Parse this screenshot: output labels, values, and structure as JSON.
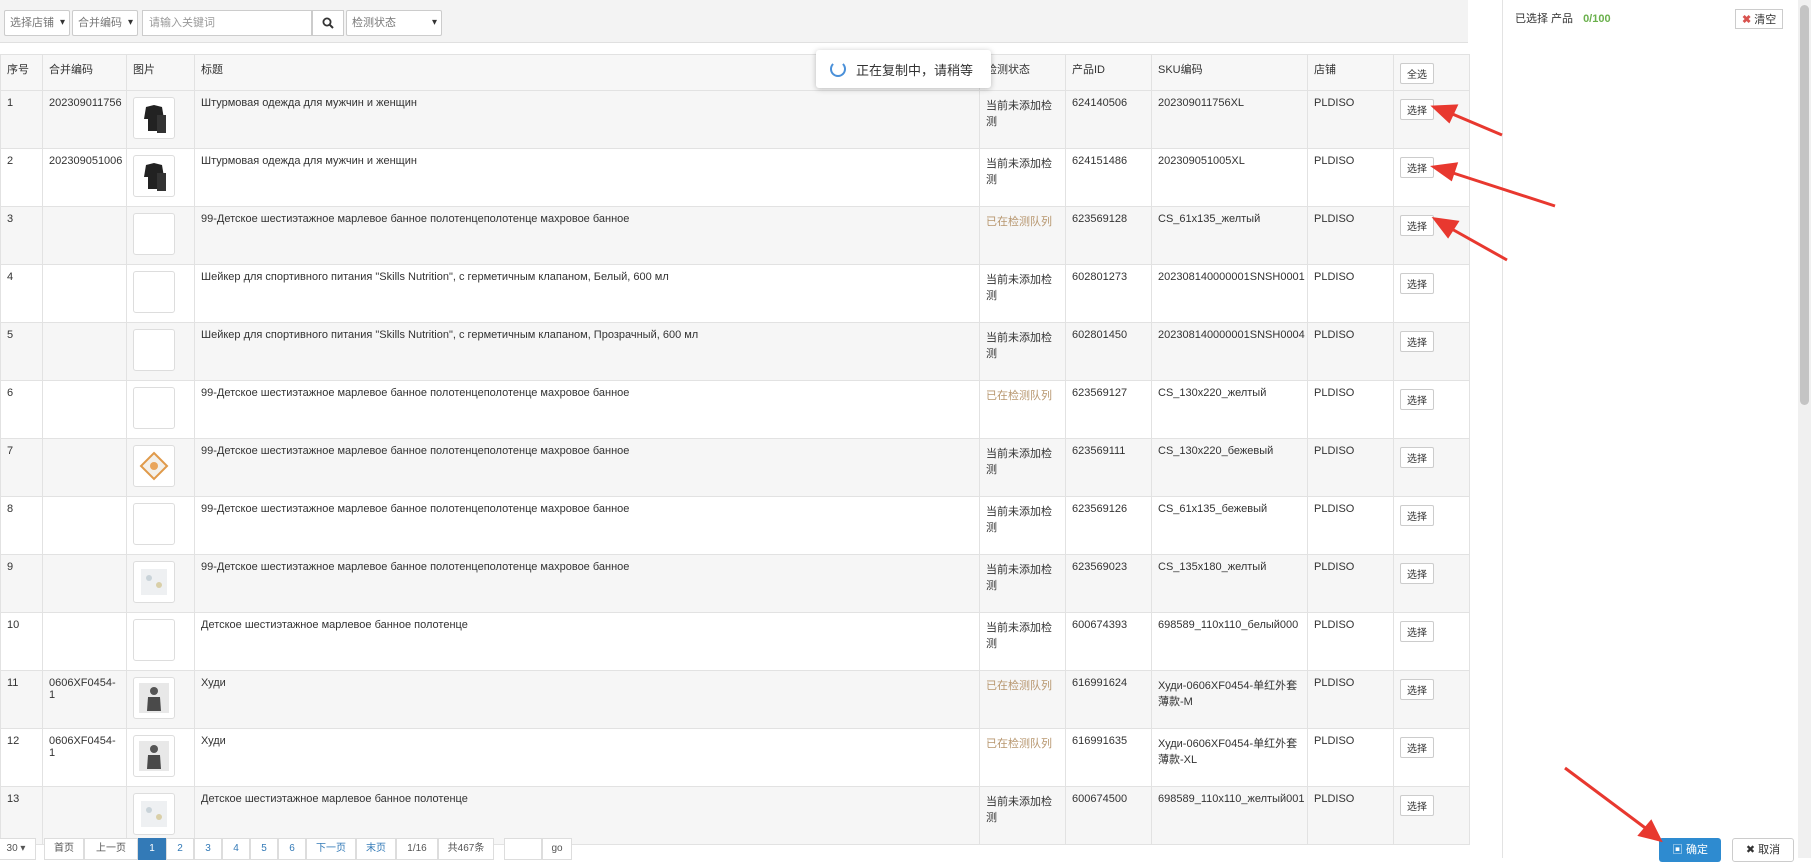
{
  "toolbar": {
    "store_select": "选择店铺",
    "merge_select": "合并编码",
    "search_placeholder": "请输入关键词",
    "status_select": "检测状态"
  },
  "table": {
    "headers": [
      "序号",
      "合并编码",
      "图片",
      "标题",
      "检测状态",
      "产品ID",
      "SKU编码",
      "店铺"
    ],
    "select_all": "全选",
    "select_label": "选择",
    "rows": [
      {
        "no": "1",
        "merge": "202309011756",
        "img": "dark",
        "title": "Штурмовая одежда для мужчин и женщин",
        "status": "当前未添加检测",
        "status_type": "none",
        "pid": "624140506",
        "sku": "202309011756XL",
        "store": "PLDISO"
      },
      {
        "no": "2",
        "merge": "202309051006",
        "img": "dark",
        "title": "Штурмовая одежда для мужчин и женщин",
        "status": "当前未添加检测",
        "status_type": "none",
        "pid": "624151486",
        "sku": "202309051005XL",
        "store": "PLDISO"
      },
      {
        "no": "3",
        "merge": "",
        "img": "blank",
        "title": "99-Детское шестиэтажное марлевое банное полотенцеполотенце махровое банное",
        "status": "已在检测队列",
        "status_type": "queued",
        "pid": "623569128",
        "sku": "CS_61x135_желтый",
        "store": "PLDISO"
      },
      {
        "no": "4",
        "merge": "",
        "img": "blank",
        "title": "Шейкер для спортивного питания \"Skills Nutrition\", с герметичным клапаном, Белый, 600 мл",
        "status": "当前未添加检测",
        "status_type": "none",
        "pid": "602801273",
        "sku": "202308140000001SNSH0001",
        "store": "PLDISO"
      },
      {
        "no": "5",
        "merge": "",
        "img": "blank",
        "title": "Шейкер для спортивного питания \"Skills Nutrition\", с герметичным клапаном, Прозрачный, 600 мл",
        "status": "当前未添加检测",
        "status_type": "none",
        "pid": "602801450",
        "sku": "202308140000001SNSH0004",
        "store": "PLDISO"
      },
      {
        "no": "6",
        "merge": "",
        "img": "blank",
        "title": "99-Детское шестиэтажное марлевое банное полотенцеполотенце махровое банное",
        "status": "已在检测队列",
        "status_type": "queued",
        "pid": "623569127",
        "sku": "CS_130x220_желтый",
        "store": "PLDISO"
      },
      {
        "no": "7",
        "merge": "",
        "img": "orange",
        "title": "99-Детское шестиэтажное марлевое банное полотенцеполотенце махровое банное",
        "status": "当前未添加检测",
        "status_type": "none",
        "pid": "623569111",
        "sku": "CS_130x220_бежевый",
        "store": "PLDISO"
      },
      {
        "no": "8",
        "merge": "",
        "img": "blank",
        "title": "99-Детское шестиэтажное марлевое банное полотенцеполотенце махровое банное",
        "status": "当前未添加检测",
        "status_type": "none",
        "pid": "623569126",
        "sku": "CS_61x135_бежевый",
        "store": "PLDISO"
      },
      {
        "no": "9",
        "merge": "",
        "img": "pale",
        "title": "99-Детское шестиэтажное марлевое банное полотенцеполотенце махровое банное",
        "status": "当前未添加检测",
        "status_type": "none",
        "pid": "623569023",
        "sku": "CS_135x180_желтый",
        "store": "PLDISO"
      },
      {
        "no": "10",
        "merge": "",
        "img": "blank",
        "title": "Детское шестиэтажное марлевое банное полотенце",
        "status": "当前未添加检测",
        "status_type": "none",
        "pid": "600674393",
        "sku": "698589_110x110_белый000",
        "store": "PLDISO"
      },
      {
        "no": "11",
        "merge": "0606XF0454-1",
        "img": "person",
        "title": "Худи",
        "status": "已在检测队列",
        "status_type": "queued",
        "pid": "616991624",
        "sku": "Худи-0606XF0454-单红外套薄款-M",
        "store": "PLDISO"
      },
      {
        "no": "12",
        "merge": "0606XF0454-1",
        "img": "person",
        "title": "Худи",
        "status": "已在检测队列",
        "status_type": "queued",
        "pid": "616991635",
        "sku": "Худи-0606XF0454-单红外套薄款-XL",
        "store": "PLDISO"
      },
      {
        "no": "13",
        "merge": "",
        "img": "pale",
        "title": "Детское шестиэтажное марлевое банное полотенце",
        "status": "当前未添加检测",
        "status_type": "none",
        "pid": "600674500",
        "sku": "698589_110x110_желтый001",
        "store": "PLDISO"
      }
    ]
  },
  "toast": {
    "text": "正在复制中，请稍等"
  },
  "right_panel": {
    "label": "已选择 产品",
    "count": "0/100",
    "clear": "清空"
  },
  "pager": {
    "page_size": "30",
    "first": "首页",
    "prev": "上一页",
    "pages": [
      "1",
      "2",
      "3",
      "4",
      "5",
      "6"
    ],
    "next": "下一页",
    "last": "末页",
    "current": "1/16",
    "total": "共467条",
    "go": "go"
  },
  "actions": {
    "confirm": "确定",
    "cancel": "取消"
  },
  "colors": {
    "accent": "#337ab7",
    "queued": "#b7966e",
    "arrow": "#e8382f",
    "count": "#6ab04c"
  }
}
